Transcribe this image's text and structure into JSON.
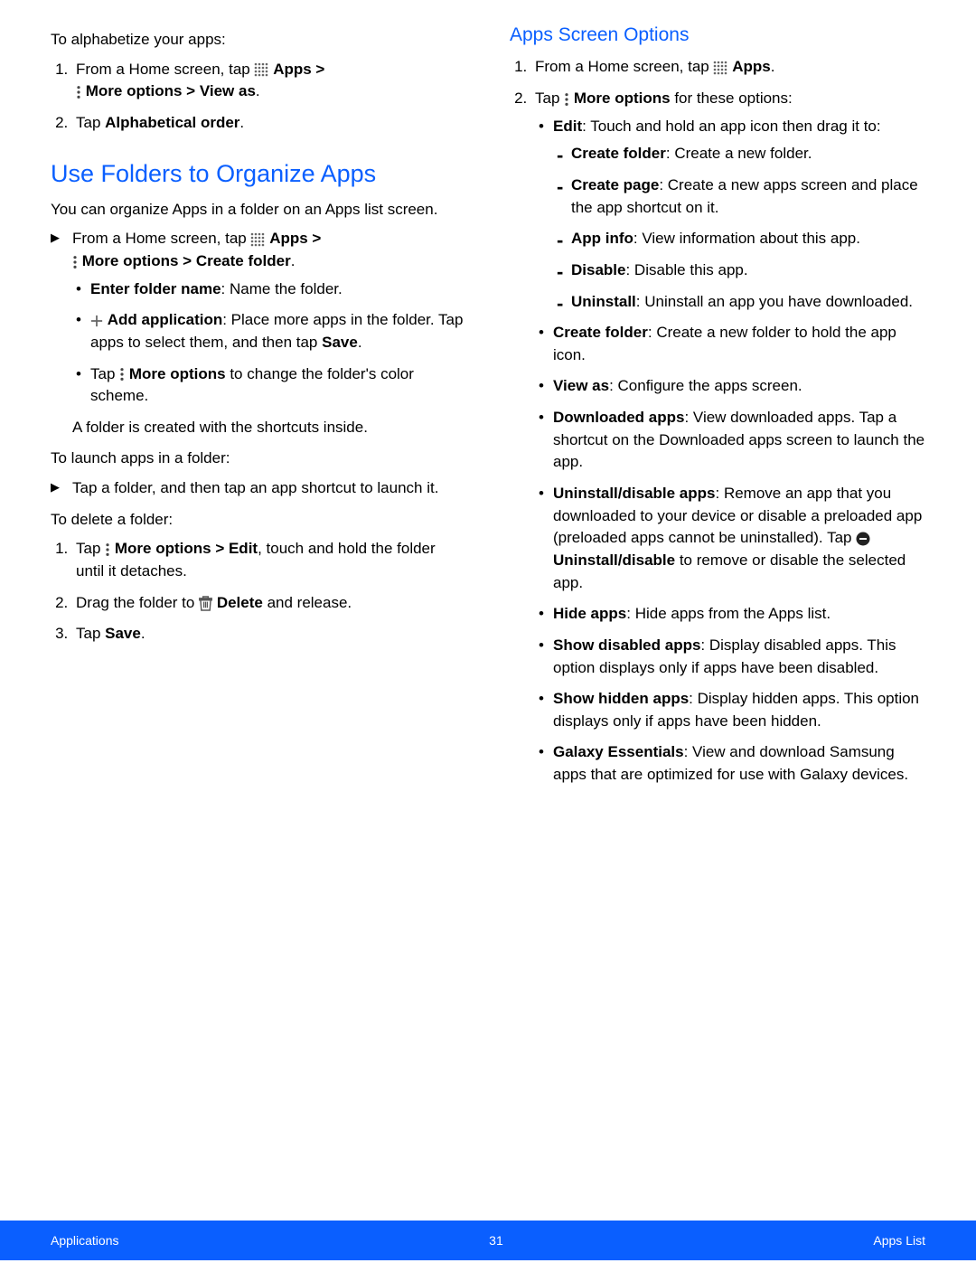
{
  "left": {
    "intro_alpha": "To alphabetize your apps:",
    "step1_prefix": "From a Home screen, tap ",
    "apps_bold": "Apps",
    "gt": " > ",
    "more_opts": "More options",
    "view_as": " > View as",
    "period": ".",
    "step2_prefix": "Tap ",
    "alpha_order": "Alphabetical order",
    "h2": "Use Folders to Organize Apps",
    "folders_intro": "You can organize Apps in a folder on an Apps list screen.",
    "from_home_prefix": "From a Home screen, tap ",
    "create_folder": " > Create folder",
    "enter_folder_b": "Enter folder name",
    "enter_folder_t": ": Name the folder.",
    "add_app_b": "Add application",
    "add_app_t": ": Place more apps in the folder. Tap apps to select them, and then tap ",
    "save_b": "Save",
    "tap_prefix": "Tap ",
    "change_color": " to change the folder's color scheme.",
    "folder_created": "A folder is created with the shortcuts inside.",
    "launch_intro": "To launch apps in a folder:",
    "launch_step": "Tap a folder, and then tap an app shortcut to launch it.",
    "delete_intro": "To delete a folder:",
    "delete1_mid": " > Edit",
    "delete1_tail": ", touch and hold the folder until it detaches.",
    "delete2_pre": "Drag the folder to ",
    "delete_b": "Delete",
    "delete2_tail": " and release.",
    "delete3": "Tap "
  },
  "right": {
    "h3": "Apps Screen Options",
    "step1_prefix": "From a Home screen, tap ",
    "step2_prefix": "Tap ",
    "step2_tail": " for these options:",
    "opt_edit_b": "Edit",
    "opt_edit_t": ": Touch and hold an app icon then drag it to:",
    "sub_createf_b": "Create folder",
    "sub_createf_t": ": Create a new folder.",
    "sub_createp_b": "Create page",
    "sub_createp_t": ": Create a new apps screen and place the app shortcut on it.",
    "sub_appinfo_b": "App info",
    "sub_appinfo_t": ": View information about this app.",
    "sub_disable_b": "Disable",
    "sub_disable_t": ": Disable this app.",
    "sub_uninst_b": "Uninstall",
    "sub_uninst_t": ": Uninstall an app you have downloaded.",
    "opt_createf_b": "Create folder",
    "opt_createf_t": ": Create a new folder to hold the app icon.",
    "opt_viewas_b": "View as",
    "opt_viewas_t": ": Configure the apps screen.",
    "opt_down_b": "Downloaded apps",
    "opt_down_t": ": View downloaded apps. Tap a shortcut on the Downloaded apps screen to launch the app.",
    "opt_undis_b": "Uninstall/disable apps",
    "opt_undis_t1": ": Remove an app that you downloaded to your device or disable a preloaded app (preloaded apps cannot be uninstalled). Tap ",
    "opt_undis_b2": "Uninstall/disable",
    "opt_undis_t2": " to remove or disable the selected app.",
    "opt_hide_b": "Hide apps",
    "opt_hide_t": ": Hide apps from the Apps list.",
    "opt_showdis_b": "Show disabled apps",
    "opt_showdis_t": ": Display disabled apps. This option displays only if apps have been disabled.",
    "opt_showhid_b": "Show hidden apps",
    "opt_showhid_t": ": Display hidden apps. This option displays only if apps have been hidden.",
    "opt_galaxy_b": "Galaxy Essentials",
    "opt_galaxy_t": ": View and download Samsung apps that are optimized for use with Galaxy devices."
  },
  "footer": {
    "left": "Applications",
    "center": "31",
    "right": "Apps List"
  }
}
